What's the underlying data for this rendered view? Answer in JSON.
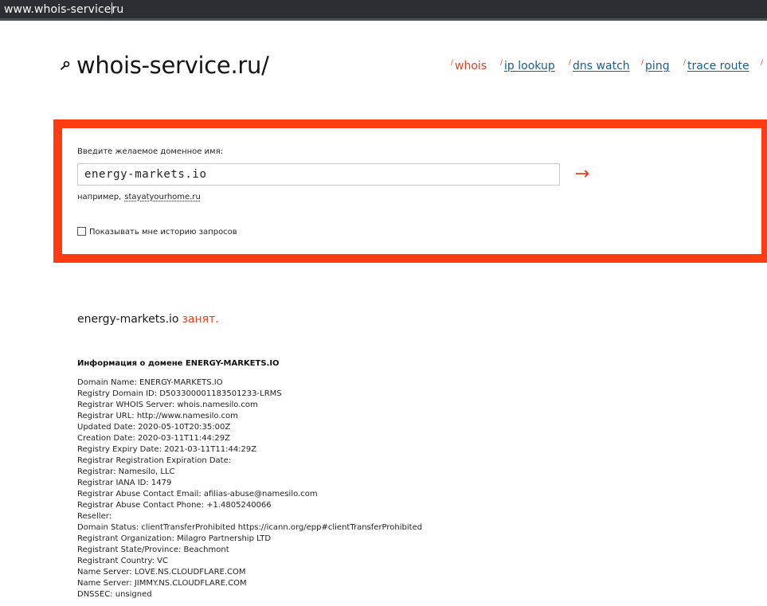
{
  "browser": {
    "url_before_caret": "www.whois-service",
    "url_after_caret": "ru"
  },
  "header": {
    "logo_icon": "magnifier-icon",
    "site_title": "whois-service.ru/",
    "nav": [
      {
        "slash": "/",
        "label": "whois",
        "active": true
      },
      {
        "slash": "/",
        "label": "ip lookup",
        "active": false
      },
      {
        "slash": "/",
        "label": "dns watch",
        "active": false
      },
      {
        "slash": "/",
        "label": "ping",
        "active": false
      },
      {
        "slash": "/",
        "label": "trace route",
        "active": false
      },
      {
        "slash": "/",
        "label": "",
        "active": false
      }
    ]
  },
  "search": {
    "label": "Введите желаемое доменное имя:",
    "value": "energy-markets.io",
    "submit_icon": "arrow-right-icon",
    "example_prefix": "например,",
    "example_link": "stayatyourhome.ru",
    "history_label": "Показывать мне историю запросов",
    "history_checked": false
  },
  "result": {
    "domain": "energy-markets.io",
    "status": "занят."
  },
  "info": {
    "title": "Информация о домене ENERGY-MARKETS.IO",
    "lines": [
      "Domain Name: ENERGY-MARKETS.IO",
      "Registry Domain ID: D503300001183501233-LRMS",
      "Registrar WHOIS Server: whois.namesilo.com",
      "Registrar URL: http://www.namesilo.com",
      "Updated Date: 2020-05-10T20:35:00Z",
      "Creation Date: 2020-03-11T11:44:29Z",
      "Registry Expiry Date: 2021-03-11T11:44:29Z",
      "Registrar Registration Expiration Date:",
      "Registrar: Namesilo, LLC",
      "Registrar IANA ID: 1479",
      "Registrar Abuse Contact Email: afilias-abuse@namesilo.com",
      "Registrar Abuse Contact Phone: +1.4805240066",
      "Reseller:",
      "Domain Status: clientTransferProhibited https://icann.org/epp#clientTransferProhibited",
      "Registrant Organization: Milagro Partnership LTD",
      "Registrant State/Province: Beachmont",
      "Registrant Country: VC",
      "Name Server: LOVE.NS.CLOUDFLARE.COM",
      "Name Server: JIMMY.NS.CLOUDFLARE.COM",
      "DNSSEC: unsigned"
    ]
  },
  "colors": {
    "accent": "#ff3b12",
    "link": "#1d5d8b",
    "taken": "#e0401e"
  }
}
